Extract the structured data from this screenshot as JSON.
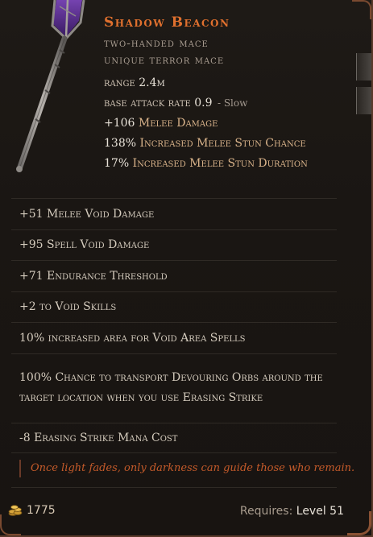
{
  "item": {
    "name": "Shadow Beacon",
    "subtype": "two-handed mace",
    "rarity": "unique terror mace"
  },
  "base_stats": {
    "range_label": "range",
    "range_value": "2.4m",
    "attack_rate_label": "base attack rate",
    "attack_rate_value": "0.9",
    "attack_rate_speed": "- Slow",
    "implicits": [
      {
        "value": "+106",
        "label": "Melee Damage"
      },
      {
        "value": "138%",
        "label": "Increased Melee Stun Chance"
      },
      {
        "value": "17%",
        "label": "Increased Melee Stun Duration"
      }
    ]
  },
  "affixes": [
    "+51 Melee Void Damage",
    "+95 Spell Void Damage",
    "+71 Endurance Threshold",
    "+2 to Void Skills",
    "10% increased area for Void Area Spells",
    "100% Chance to transport Devouring Orbs around the target location when you use Erasing Strike",
    "-8 Erasing Strike Mana Cost"
  ],
  "flavor_text": "Once light fades, only darkness can guide those who remain.",
  "footer": {
    "gold_value": "1775",
    "requires_label": "Requires:",
    "requires_level": "Level 51"
  },
  "colors": {
    "unique_name": "#e0702e",
    "flavor": "#c45a2a",
    "void_glow": "#5a2a8a"
  },
  "icons": {
    "weapon": "staff-mace-icon",
    "gold": "gold-coins-icon"
  }
}
